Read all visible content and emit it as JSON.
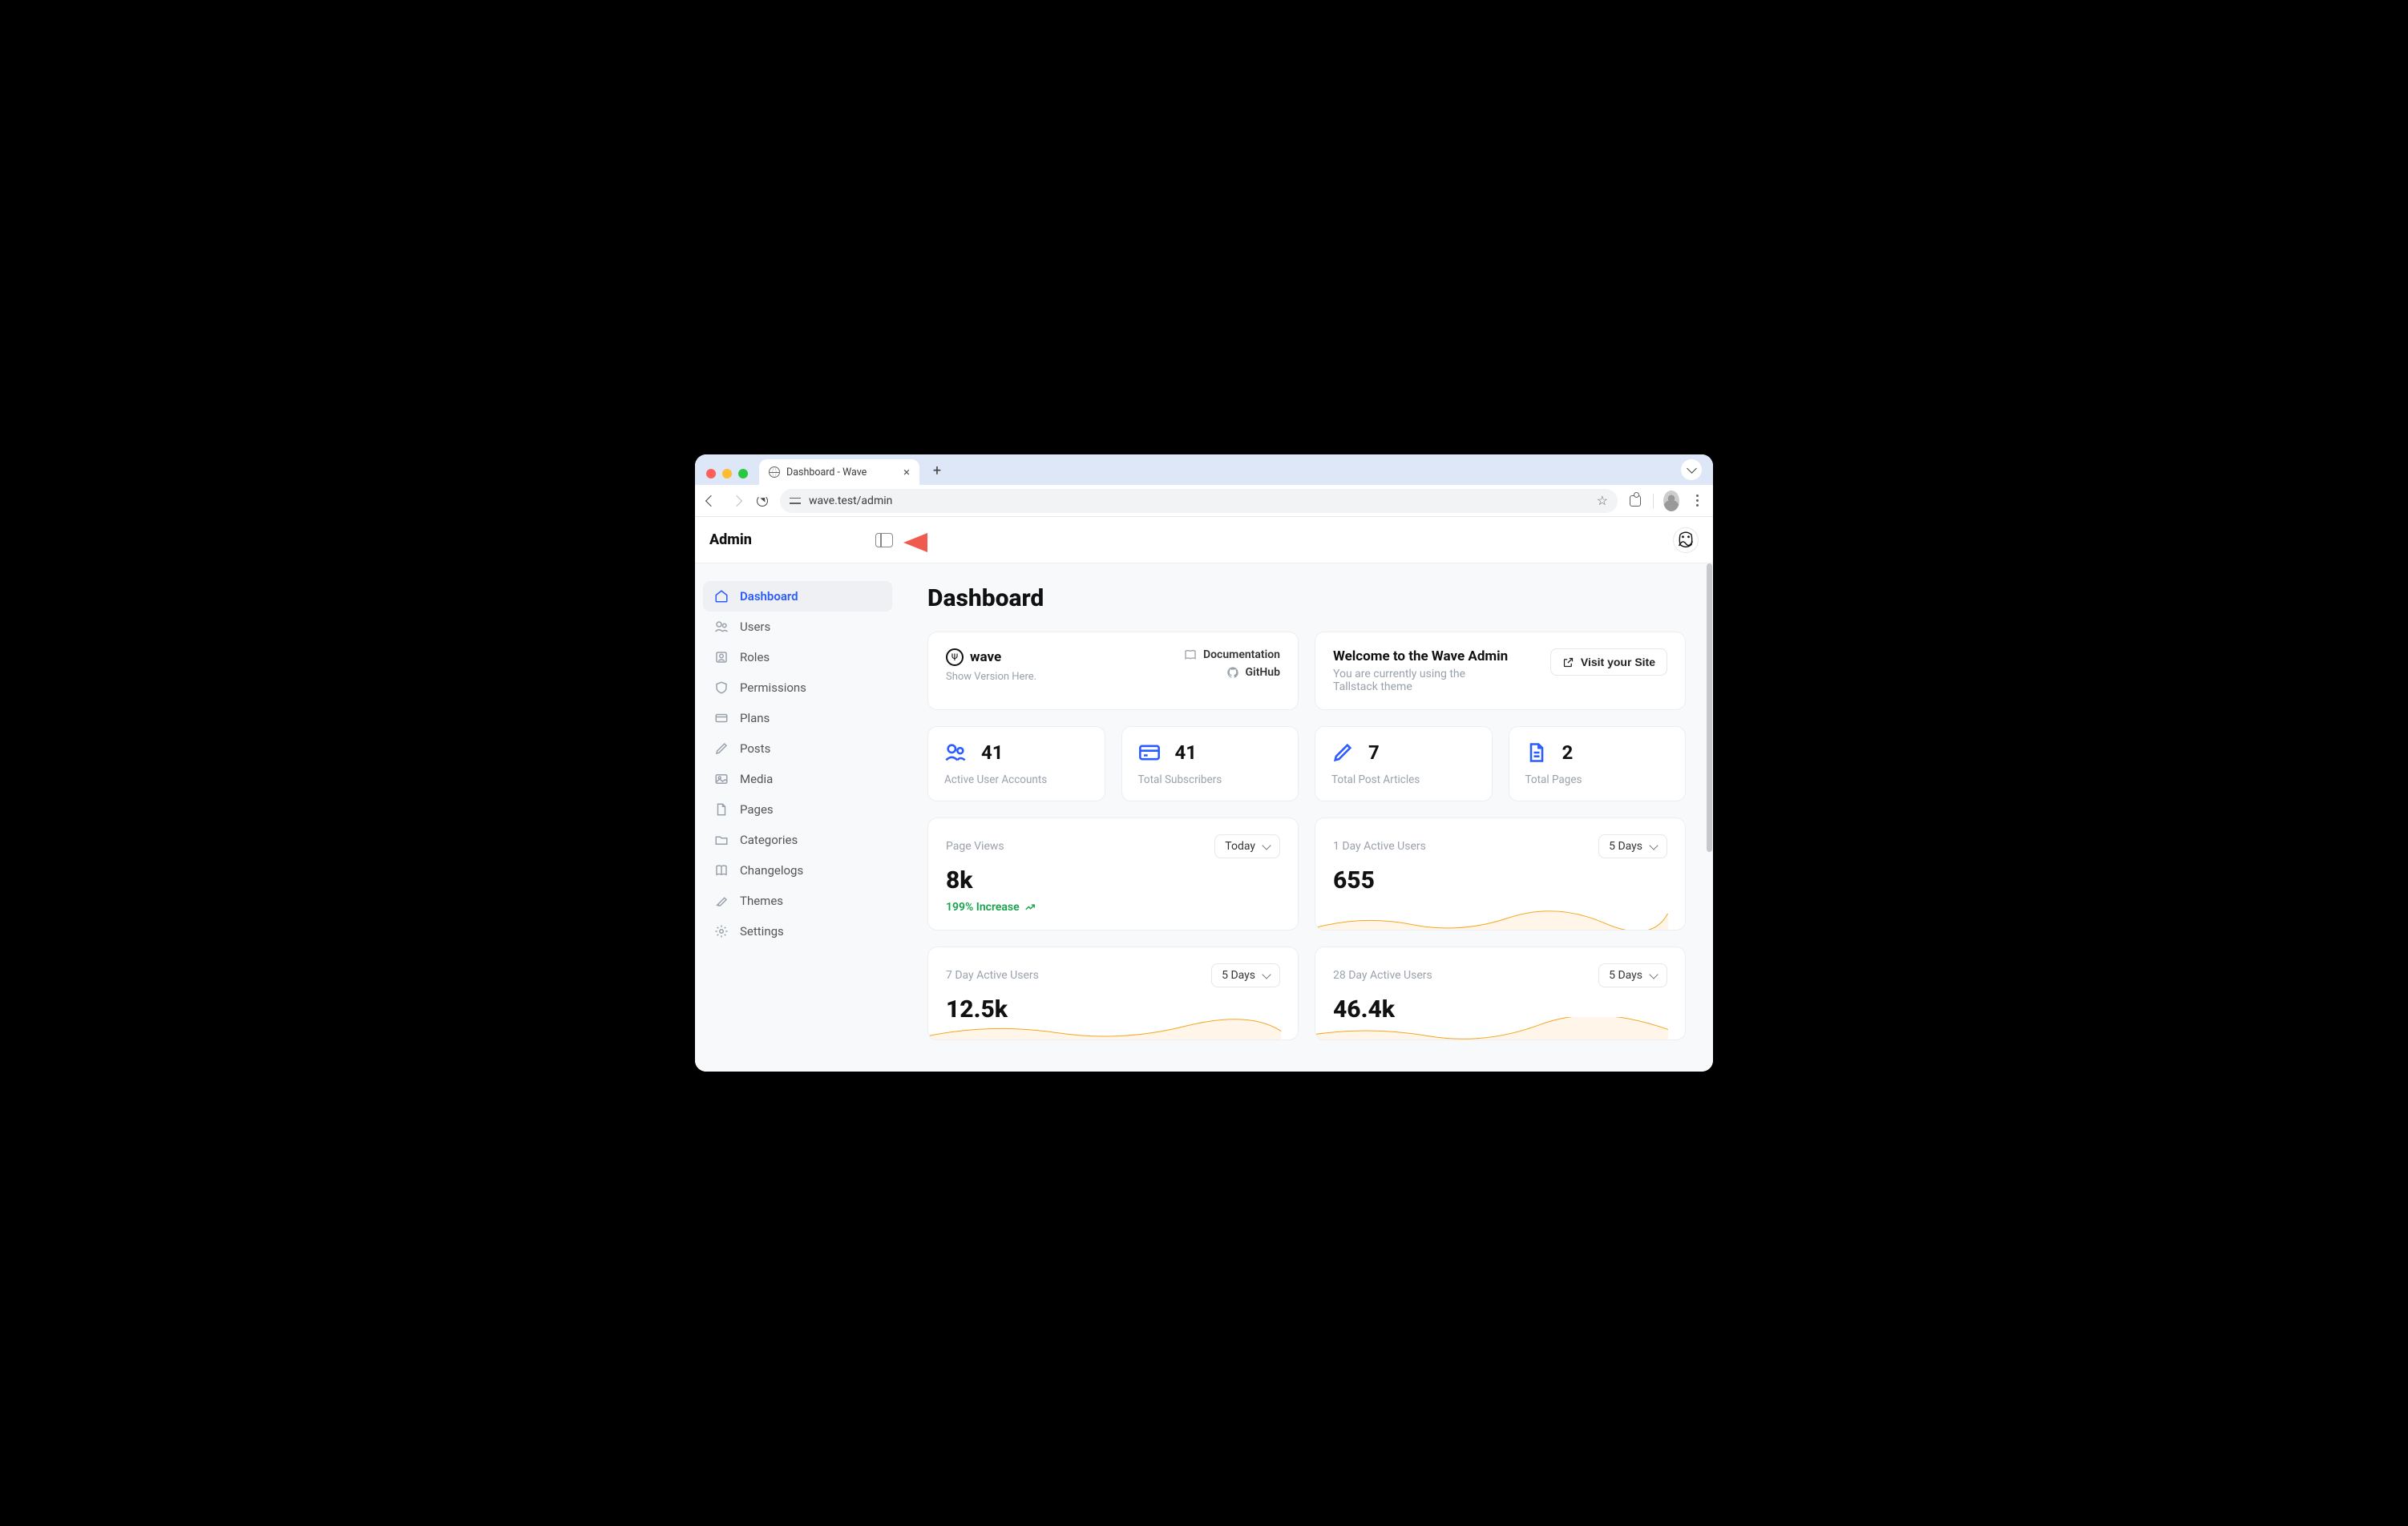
{
  "browser": {
    "tab_title": "Dashboard - Wave",
    "url": "wave.test/admin"
  },
  "header": {
    "brand": "Admin"
  },
  "sidebar": {
    "items": [
      {
        "label": "Dashboard",
        "icon": "home"
      },
      {
        "label": "Users",
        "icon": "users"
      },
      {
        "label": "Roles",
        "icon": "badge"
      },
      {
        "label": "Permissions",
        "icon": "shield"
      },
      {
        "label": "Plans",
        "icon": "card"
      },
      {
        "label": "Posts",
        "icon": "pencil"
      },
      {
        "label": "Media",
        "icon": "image"
      },
      {
        "label": "Pages",
        "icon": "page"
      },
      {
        "label": "Categories",
        "icon": "folder"
      },
      {
        "label": "Changelogs",
        "icon": "book"
      },
      {
        "label": "Themes",
        "icon": "paint"
      },
      {
        "label": "Settings",
        "icon": "gear"
      }
    ]
  },
  "page": {
    "title": "Dashboard"
  },
  "wave_card": {
    "name": "wave",
    "version_text": "Show Version Here.",
    "links": {
      "documentation": "Documentation",
      "github": "GitHub"
    }
  },
  "welcome_card": {
    "title": "Welcome to the Wave Admin",
    "subtitle": "You are currently using the Tallstack theme",
    "button": "Visit your Site"
  },
  "stats": [
    {
      "value": "41",
      "label": "Active User Accounts",
      "icon": "users"
    },
    {
      "value": "41",
      "label": "Total Subscribers",
      "icon": "card"
    },
    {
      "value": "7",
      "label": "Total Post Articles",
      "icon": "pencil"
    },
    {
      "value": "2",
      "label": "Total Pages",
      "icon": "page"
    }
  ],
  "metrics": [
    {
      "label": "Page Views",
      "value": "8k",
      "range": "Today",
      "trend": "199% Increase",
      "spark": true
    },
    {
      "label": "1 Day Active Users",
      "value": "655",
      "range": "5 Days",
      "spark": true
    },
    {
      "label": "7 Day Active Users",
      "value": "12.5k",
      "range": "5 Days",
      "spark": true
    },
    {
      "label": "28 Day Active Users",
      "value": "46.4k",
      "range": "5 Days",
      "spark": true
    }
  ]
}
